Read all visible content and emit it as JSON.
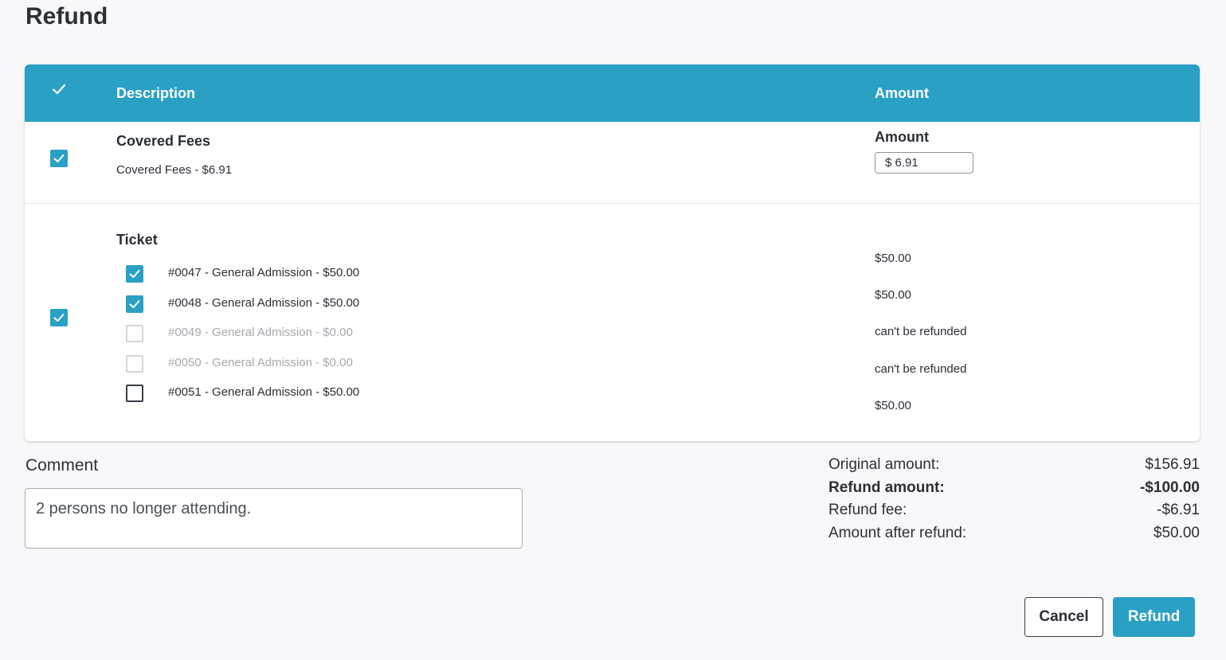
{
  "page": {
    "title": "Refund"
  },
  "table": {
    "header": {
      "description": "Description",
      "amount": "Amount"
    },
    "covered_fees": {
      "checked": true,
      "title": "Covered Fees",
      "subtitle": "Covered Fees - $6.91",
      "amount_label": "Amount",
      "amount_value": "$ 6.91"
    },
    "ticket": {
      "checked": true,
      "title": "Ticket",
      "items": [
        {
          "label": "#0047 - General Admission - $50.00",
          "amount": "$50.00",
          "state": "checked"
        },
        {
          "label": "#0048 - General Admission - $50.00",
          "amount": "$50.00",
          "state": "checked"
        },
        {
          "label": "#0049 - General Admission - $0.00",
          "amount": "can't be refunded",
          "state": "disabled"
        },
        {
          "label": "#0050 - General Admission - $0.00",
          "amount": "can't be refunded",
          "state": "disabled"
        },
        {
          "label": "#0051 - General Admission - $50.00",
          "amount": "$50.00",
          "state": "unchecked"
        }
      ]
    }
  },
  "comment": {
    "label": "Comment",
    "value": "2 persons no longer attending."
  },
  "summary": {
    "original_label": "Original amount:",
    "original_value": "$156.91",
    "refund_label": "Refund amount:",
    "refund_value": "-$100.00",
    "fee_label": "Refund fee:",
    "fee_value": "-$6.91",
    "after_label": "Amount after refund:",
    "after_value": "$50.00"
  },
  "actions": {
    "cancel": "Cancel",
    "refund": "Refund"
  },
  "colors": {
    "accent": "#2aa0c4",
    "text": "#2b2f36",
    "disabled_text": "#a6a9ae"
  }
}
